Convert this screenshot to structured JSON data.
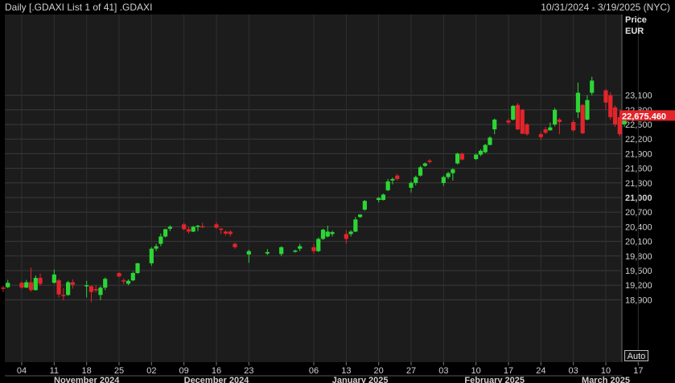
{
  "header": {
    "title": "Daily [.GDAXI List 1 of 41] .GDAXI",
    "date_range": "10/31/2024 - 3/19/2025 (NYC)"
  },
  "auto_button_label": "Auto",
  "chart_data": {
    "type": "candlestick",
    "axis_title": "Price",
    "axis_unit": "EUR",
    "last_price": "22,675.460",
    "yticks": [
      {
        "value": 23100,
        "label": "23,100"
      },
      {
        "value": 22800,
        "label": "22,800"
      },
      {
        "value": 22500,
        "label": "22,500"
      },
      {
        "value": 22200,
        "label": "22,200"
      },
      {
        "value": 21900,
        "label": "21,900"
      },
      {
        "value": 21600,
        "label": "21,600"
      },
      {
        "value": 21300,
        "label": "21,300"
      },
      {
        "value": 21000,
        "label": "21,000"
      },
      {
        "value": 20700,
        "label": "20,700"
      },
      {
        "value": 20400,
        "label": "20,400"
      },
      {
        "value": 20100,
        "label": "20,100"
      },
      {
        "value": 19800,
        "label": "19,800"
      },
      {
        "value": 19500,
        "label": "19,500"
      },
      {
        "value": 19200,
        "label": "19,200"
      },
      {
        "value": 18900,
        "label": "18,900"
      }
    ],
    "xticks": [
      {
        "date": "2024-11-04",
        "label": "04"
      },
      {
        "date": "2024-11-11",
        "label": "11"
      },
      {
        "date": "2024-11-18",
        "label": "18"
      },
      {
        "date": "2024-11-25",
        "label": "25"
      },
      {
        "date": "2024-12-02",
        "label": "02"
      },
      {
        "date": "2024-12-09",
        "label": "09"
      },
      {
        "date": "2024-12-16",
        "label": "16"
      },
      {
        "date": "2024-12-23",
        "label": "23"
      },
      {
        "date": "2025-01-06",
        "label": "06"
      },
      {
        "date": "2025-01-13",
        "label": "13"
      },
      {
        "date": "2025-01-20",
        "label": "20"
      },
      {
        "date": "2025-01-27",
        "label": "27"
      },
      {
        "date": "2025-02-03",
        "label": "03"
      },
      {
        "date": "2025-02-10",
        "label": "10"
      },
      {
        "date": "2025-02-17",
        "label": "17"
      },
      {
        "date": "2025-02-24",
        "label": "24"
      },
      {
        "date": "2025-03-03",
        "label": "03"
      },
      {
        "date": "2025-03-10",
        "label": "10"
      },
      {
        "date": "2025-03-17",
        "label": "17"
      }
    ],
    "months": [
      {
        "label": "November 2024",
        "date": "2024-11-18"
      },
      {
        "label": "December 2024",
        "date": "2024-12-16"
      },
      {
        "label": "January 2025",
        "date": "2025-01-16"
      },
      {
        "label": "February 2025",
        "date": "2025-02-14"
      },
      {
        "label": "March 2025",
        "date": "2025-03-10"
      }
    ],
    "candles": [
      {
        "date": "2024-10-31",
        "o": 19150,
        "h": 19190,
        "l": 19060,
        "c": 19130
      },
      {
        "date": "2024-11-01",
        "o": 19160,
        "h": 19310,
        "l": 19140,
        "c": 19250
      },
      {
        "date": "2024-11-04",
        "o": 19250,
        "h": 19280,
        "l": 19130,
        "c": 19150
      },
      {
        "date": "2024-11-05",
        "o": 19150,
        "h": 19310,
        "l": 19140,
        "c": 19260
      },
      {
        "date": "2024-11-06",
        "o": 19260,
        "h": 19560,
        "l": 19070,
        "c": 19100
      },
      {
        "date": "2024-11-07",
        "o": 19100,
        "h": 19400,
        "l": 19090,
        "c": 19350
      },
      {
        "date": "2024-11-08",
        "o": 19350,
        "h": 19440,
        "l": 19190,
        "c": 19230
      },
      {
        "date": "2024-11-11",
        "o": 19250,
        "h": 19520,
        "l": 19230,
        "c": 19420
      },
      {
        "date": "2024-11-12",
        "o": 19300,
        "h": 19330,
        "l": 18950,
        "c": 19010
      },
      {
        "date": "2024-11-13",
        "o": 19000,
        "h": 19140,
        "l": 18890,
        "c": 18990
      },
      {
        "date": "2024-11-14",
        "o": 19000,
        "h": 19290,
        "l": 18980,
        "c": 19260
      },
      {
        "date": "2024-11-15",
        "o": 19260,
        "h": 19320,
        "l": 19130,
        "c": 19210
      },
      {
        "date": "2024-11-18",
        "o": 19200,
        "h": 19290,
        "l": 18950,
        "c": 19200
      },
      {
        "date": "2024-11-19",
        "o": 19180,
        "h": 19190,
        "l": 18850,
        "c": 19060
      },
      {
        "date": "2024-11-20",
        "o": 19120,
        "h": 19200,
        "l": 19050,
        "c": 19100
      },
      {
        "date": "2024-11-21",
        "o": 19000,
        "h": 19180,
        "l": 18890,
        "c": 19150
      },
      {
        "date": "2024-11-22",
        "o": 19150,
        "h": 19360,
        "l": 19100,
        "c": 19330
      },
      {
        "date": "2024-11-25",
        "o": 19450,
        "h": 19470,
        "l": 19360,
        "c": 19380
      },
      {
        "date": "2024-11-26",
        "o": 19300,
        "h": 19340,
        "l": 19220,
        "c": 19280
      },
      {
        "date": "2024-11-27",
        "o": 19230,
        "h": 19320,
        "l": 19200,
        "c": 19290
      },
      {
        "date": "2024-11-28",
        "o": 19300,
        "h": 19480,
        "l": 19280,
        "c": 19450
      },
      {
        "date": "2024-11-29",
        "o": 19450,
        "h": 19660,
        "l": 19430,
        "c": 19650
      },
      {
        "date": "2024-12-02",
        "o": 19650,
        "h": 19980,
        "l": 19600,
        "c": 19950
      },
      {
        "date": "2024-12-03",
        "o": 19950,
        "h": 20050,
        "l": 19900,
        "c": 20000
      },
      {
        "date": "2024-12-04",
        "o": 20050,
        "h": 20260,
        "l": 20000,
        "c": 20200
      },
      {
        "date": "2024-12-05",
        "o": 20200,
        "h": 20360,
        "l": 20180,
        "c": 20350
      },
      {
        "date": "2024-12-06",
        "o": 20360,
        "h": 20430,
        "l": 20310,
        "c": 20400
      },
      {
        "date": "2024-12-09",
        "o": 20450,
        "h": 20480,
        "l": 20330,
        "c": 20350
      },
      {
        "date": "2024-12-10",
        "o": 20350,
        "h": 20400,
        "l": 20260,
        "c": 20300
      },
      {
        "date": "2024-12-11",
        "o": 20300,
        "h": 20420,
        "l": 20290,
        "c": 20400
      },
      {
        "date": "2024-12-12",
        "o": 20400,
        "h": 20440,
        "l": 20310,
        "c": 20420
      },
      {
        "date": "2024-12-13",
        "o": 20410,
        "h": 20480,
        "l": 20380,
        "c": 20400
      },
      {
        "date": "2024-12-16",
        "o": 20450,
        "h": 20490,
        "l": 20360,
        "c": 20380
      },
      {
        "date": "2024-12-17",
        "o": 20360,
        "h": 20380,
        "l": 20250,
        "c": 20340
      },
      {
        "date": "2024-12-18",
        "o": 20300,
        "h": 20330,
        "l": 20220,
        "c": 20260
      },
      {
        "date": "2024-12-19",
        "o": 20300,
        "h": 20330,
        "l": 20200,
        "c": 20250
      },
      {
        "date": "2024-12-20",
        "o": 20050,
        "h": 20070,
        "l": 19950,
        "c": 19980
      },
      {
        "date": "2024-12-23",
        "o": 19830,
        "h": 19930,
        "l": 19660,
        "c": 19900
      },
      {
        "date": "2024-12-27",
        "o": 19850,
        "h": 19940,
        "l": 19820,
        "c": 19880
      },
      {
        "date": "2024-12-30",
        "o": 19840,
        "h": 20000,
        "l": 19800,
        "c": 19980
      },
      {
        "date": "2025-01-02",
        "o": 19900,
        "h": 19930,
        "l": 19870,
        "c": 19910
      },
      {
        "date": "2025-01-03",
        "o": 19950,
        "h": 20050,
        "l": 19900,
        "c": 20000
      },
      {
        "date": "2025-01-06",
        "o": 19980,
        "h": 20050,
        "l": 19850,
        "c": 19900
      },
      {
        "date": "2025-01-07",
        "o": 19900,
        "h": 20180,
        "l": 19880,
        "c": 20150
      },
      {
        "date": "2025-01-08",
        "o": 20150,
        "h": 20360,
        "l": 20130,
        "c": 20340
      },
      {
        "date": "2025-01-09",
        "o": 20200,
        "h": 20420,
        "l": 20180,
        "c": 20300
      },
      {
        "date": "2025-01-10",
        "o": 20250,
        "h": 20320,
        "l": 20200,
        "c": 20290
      },
      {
        "date": "2025-01-13",
        "o": 20250,
        "h": 20330,
        "l": 20050,
        "c": 20150
      },
      {
        "date": "2025-01-14",
        "o": 20250,
        "h": 20330,
        "l": 20200,
        "c": 20300
      },
      {
        "date": "2025-01-15",
        "o": 20300,
        "h": 20600,
        "l": 20290,
        "c": 20550
      },
      {
        "date": "2025-01-16",
        "o": 20600,
        "h": 20660,
        "l": 20580,
        "c": 20650
      },
      {
        "date": "2025-01-17",
        "o": 20750,
        "h": 20950,
        "l": 20730,
        "c": 20930
      },
      {
        "date": "2025-01-20",
        "o": 20950,
        "h": 21010,
        "l": 20900,
        "c": 20990
      },
      {
        "date": "2025-01-21",
        "o": 20950,
        "h": 21080,
        "l": 20940,
        "c": 21060
      },
      {
        "date": "2025-01-22",
        "o": 21150,
        "h": 21380,
        "l": 21130,
        "c": 21330
      },
      {
        "date": "2025-01-23",
        "o": 21350,
        "h": 21410,
        "l": 21270,
        "c": 21380
      },
      {
        "date": "2025-01-24",
        "o": 21450,
        "h": 21480,
        "l": 21350,
        "c": 21380
      },
      {
        "date": "2025-01-27",
        "o": 21200,
        "h": 21330,
        "l": 21100,
        "c": 21300
      },
      {
        "date": "2025-01-28",
        "o": 21300,
        "h": 21450,
        "l": 21250,
        "c": 21420
      },
      {
        "date": "2025-01-29",
        "o": 21450,
        "h": 21650,
        "l": 21430,
        "c": 21620
      },
      {
        "date": "2025-01-30",
        "o": 21650,
        "h": 21720,
        "l": 21630,
        "c": 21700
      },
      {
        "date": "2025-01-31",
        "o": 21760,
        "h": 21790,
        "l": 21700,
        "c": 21730
      },
      {
        "date": "2025-02-03",
        "o": 21300,
        "h": 21450,
        "l": 21240,
        "c": 21420
      },
      {
        "date": "2025-02-04",
        "o": 21420,
        "h": 21530,
        "l": 21380,
        "c": 21500
      },
      {
        "date": "2025-02-05",
        "o": 21500,
        "h": 21600,
        "l": 21350,
        "c": 21580
      },
      {
        "date": "2025-02-06",
        "o": 21700,
        "h": 21920,
        "l": 21680,
        "c": 21900
      },
      {
        "date": "2025-02-07",
        "o": 21900,
        "h": 21920,
        "l": 21760,
        "c": 21780
      },
      {
        "date": "2025-02-10",
        "o": 21790,
        "h": 21900,
        "l": 21770,
        "c": 21880
      },
      {
        "date": "2025-02-11",
        "o": 21880,
        "h": 21990,
        "l": 21850,
        "c": 21960
      },
      {
        "date": "2025-02-12",
        "o": 21930,
        "h": 22100,
        "l": 21910,
        "c": 22080
      },
      {
        "date": "2025-02-13",
        "o": 22080,
        "h": 22260,
        "l": 22070,
        "c": 22230
      },
      {
        "date": "2025-02-14",
        "o": 22400,
        "h": 22620,
        "l": 22300,
        "c": 22600
      },
      {
        "date": "2025-02-17",
        "o": 22580,
        "h": 22620,
        "l": 22500,
        "c": 22540
      },
      {
        "date": "2025-02-18",
        "o": 22600,
        "h": 22900,
        "l": 22580,
        "c": 22880
      },
      {
        "date": "2025-02-19",
        "o": 22900,
        "h": 22940,
        "l": 22380,
        "c": 22400
      },
      {
        "date": "2025-02-20",
        "o": 22800,
        "h": 22820,
        "l": 22300,
        "c": 22310
      },
      {
        "date": "2025-02-21",
        "o": 22500,
        "h": 22530,
        "l": 22270,
        "c": 22300
      },
      {
        "date": "2025-02-24",
        "o": 22300,
        "h": 22350,
        "l": 22180,
        "c": 22240
      },
      {
        "date": "2025-02-25",
        "o": 22400,
        "h": 22450,
        "l": 22300,
        "c": 22330
      },
      {
        "date": "2025-02-26",
        "o": 22380,
        "h": 22540,
        "l": 22370,
        "c": 22440
      },
      {
        "date": "2025-02-27",
        "o": 22500,
        "h": 22840,
        "l": 22460,
        "c": 22800
      },
      {
        "date": "2025-02-28",
        "o": 22600,
        "h": 22630,
        "l": 22300,
        "c": 22550
      },
      {
        "date": "2025-03-03",
        "o": 22550,
        "h": 22600,
        "l": 22350,
        "c": 22380
      },
      {
        "date": "2025-03-04",
        "o": 22750,
        "h": 23360,
        "l": 22630,
        "c": 23150
      },
      {
        "date": "2025-03-05",
        "o": 22900,
        "h": 22920,
        "l": 22300,
        "c": 22320
      },
      {
        "date": "2025-03-06",
        "o": 22600,
        "h": 23100,
        "l": 22580,
        "c": 23000
      },
      {
        "date": "2025-03-07",
        "o": 23150,
        "h": 23480,
        "l": 23100,
        "c": 23400
      },
      {
        "date": "2025-03-10",
        "o": 23200,
        "h": 23230,
        "l": 22800,
        "c": 22950
      },
      {
        "date": "2025-03-11",
        "o": 23100,
        "h": 23160,
        "l": 22600,
        "c": 22650
      },
      {
        "date": "2025-03-12",
        "o": 22850,
        "h": 22890,
        "l": 22450,
        "c": 22500
      },
      {
        "date": "2025-03-13",
        "o": 22650,
        "h": 22700,
        "l": 22250,
        "c": 22300
      },
      {
        "date": "2025-03-14",
        "o": 22500,
        "h": 22780,
        "l": 22450,
        "c": 22680
      }
    ]
  }
}
